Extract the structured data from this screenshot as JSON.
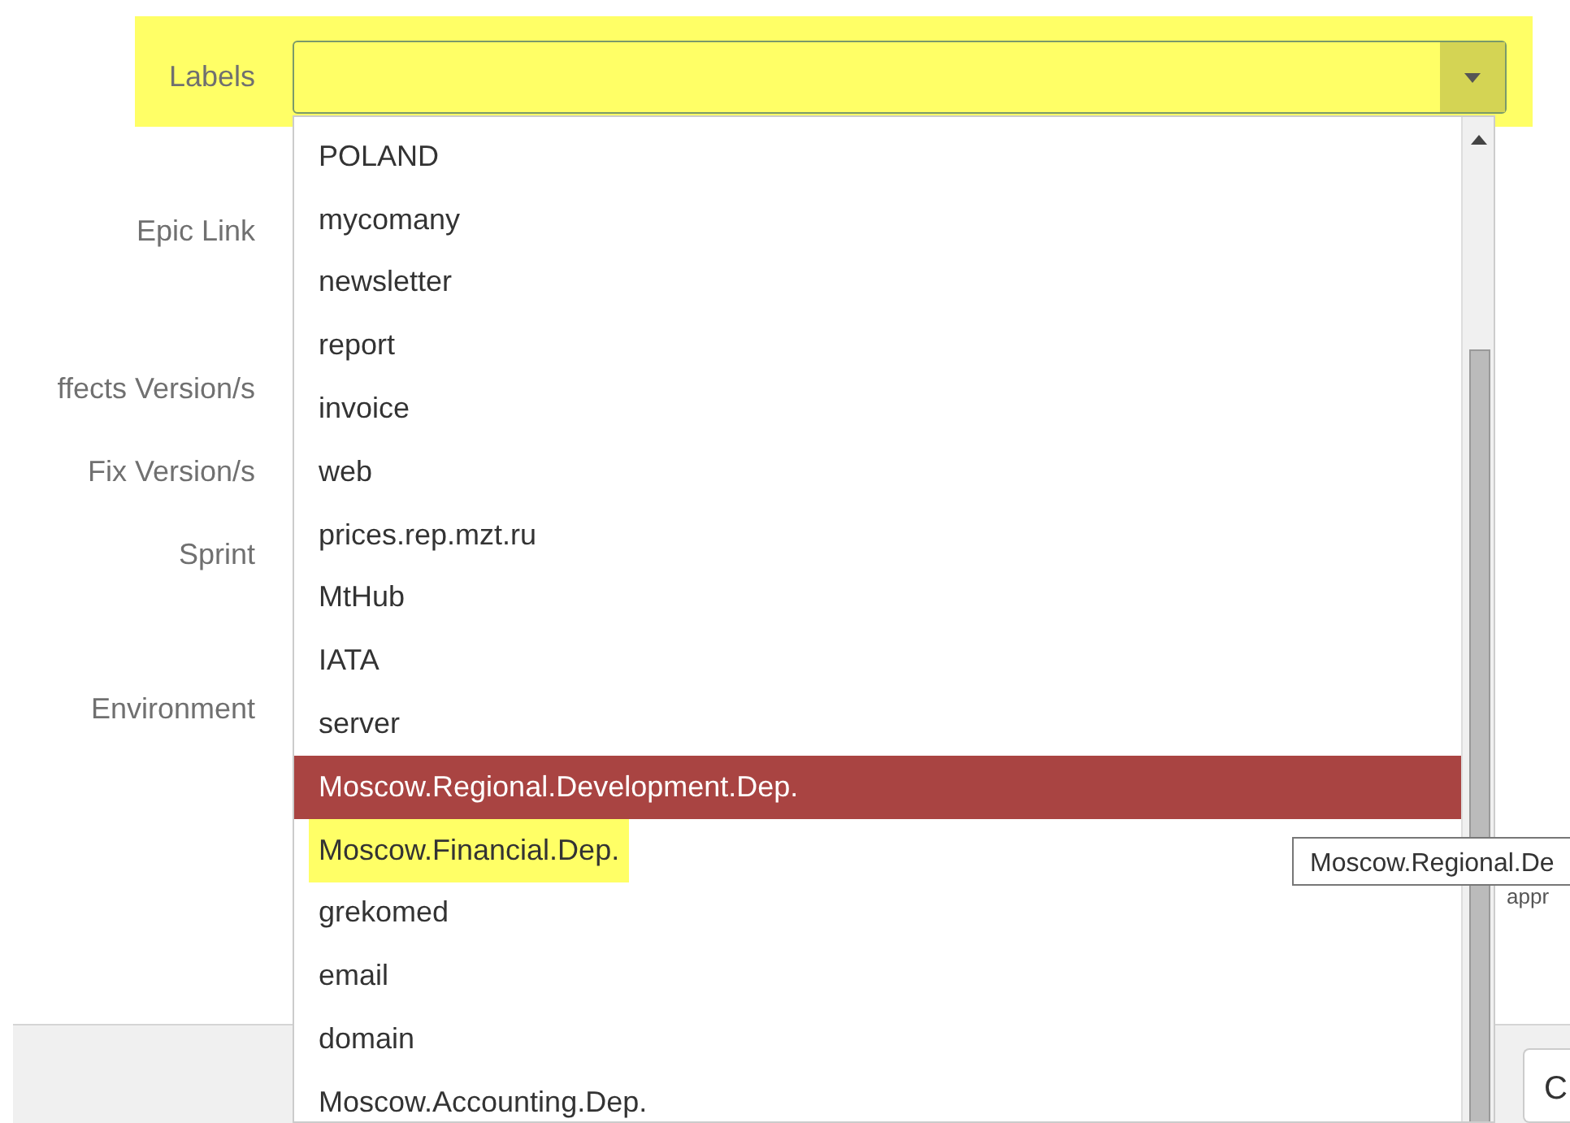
{
  "form": {
    "fields": [
      {
        "label": "Labels",
        "marked": true
      },
      {
        "label": "Epic Link"
      },
      {
        "label": "ffects Version/s"
      },
      {
        "label": "Fix Version/s"
      },
      {
        "label": "Sprint"
      },
      {
        "label": "Environment"
      }
    ]
  },
  "dropdown": {
    "items": [
      {
        "label": "POLAND",
        "selected": false,
        "marked": false
      },
      {
        "label": "mycomany",
        "selected": false,
        "marked": false
      },
      {
        "label": "newsletter",
        "selected": false,
        "marked": false
      },
      {
        "label": "report",
        "selected": false,
        "marked": false
      },
      {
        "label": "invoice",
        "selected": false,
        "marked": false
      },
      {
        "label": "web",
        "selected": false,
        "marked": false
      },
      {
        "label": "prices.rep.mzt.ru",
        "selected": false,
        "marked": false
      },
      {
        "label": "MtHub",
        "selected": false,
        "marked": false
      },
      {
        "label": "IATA",
        "selected": false,
        "marked": false
      },
      {
        "label": "server",
        "selected": false,
        "marked": false
      },
      {
        "label": "Moscow.Regional.Development.Dep.",
        "selected": true,
        "marked": false
      },
      {
        "label": "Moscow.Financial.Dep.",
        "selected": false,
        "marked": true
      },
      {
        "label": "grekomed",
        "selected": false,
        "marked": false
      },
      {
        "label": "email",
        "selected": false,
        "marked": false
      },
      {
        "label": "domain",
        "selected": false,
        "marked": false
      },
      {
        "label": "Moscow.Accounting.Dep.",
        "selected": false,
        "marked": false
      }
    ]
  },
  "tooltip": "Moscow.Regional.De",
  "hint": "appr",
  "footer": {
    "button": "C"
  }
}
